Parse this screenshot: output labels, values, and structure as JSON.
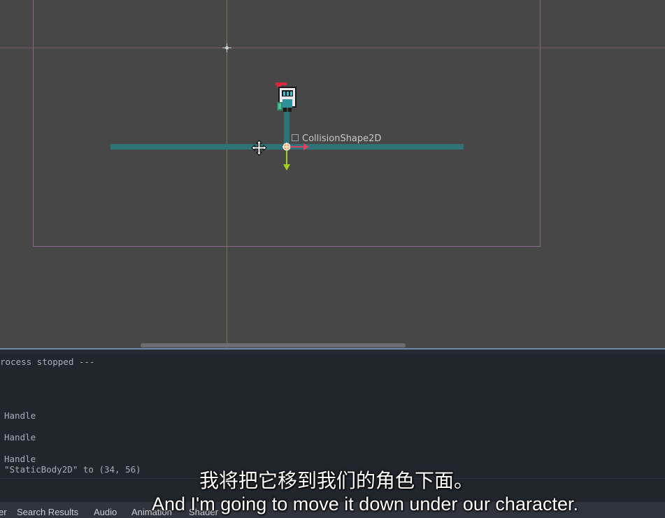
{
  "viewport": {
    "node_label": "CollisionShape2D"
  },
  "output": {
    "lines": [
      "rocess stopped ---",
      "Handle",
      "Handle",
      "Handle",
      "\"StaticBody2D\" to (34, 56)"
    ]
  },
  "bottom_tabs": [
    {
      "label": "er"
    },
    {
      "label": "Search Results"
    },
    {
      "label": "Audio"
    },
    {
      "label": "Animation"
    },
    {
      "label": "Shader"
    }
  ],
  "subtitles": {
    "chinese": "我将把它移到我们的角色下面。",
    "english": "And I'm going to move it down under our character."
  },
  "colors": {
    "viewport_bg": "#474747",
    "collision_shape": "#2d7378",
    "output_bg": "#21252c",
    "panel_divider": "#6b8fb0"
  },
  "icons": [
    "origin-crosshair-icon",
    "move-cursor-icon",
    "knight-sprite",
    "transform-gizmo-icon",
    "node-type-icon"
  ]
}
